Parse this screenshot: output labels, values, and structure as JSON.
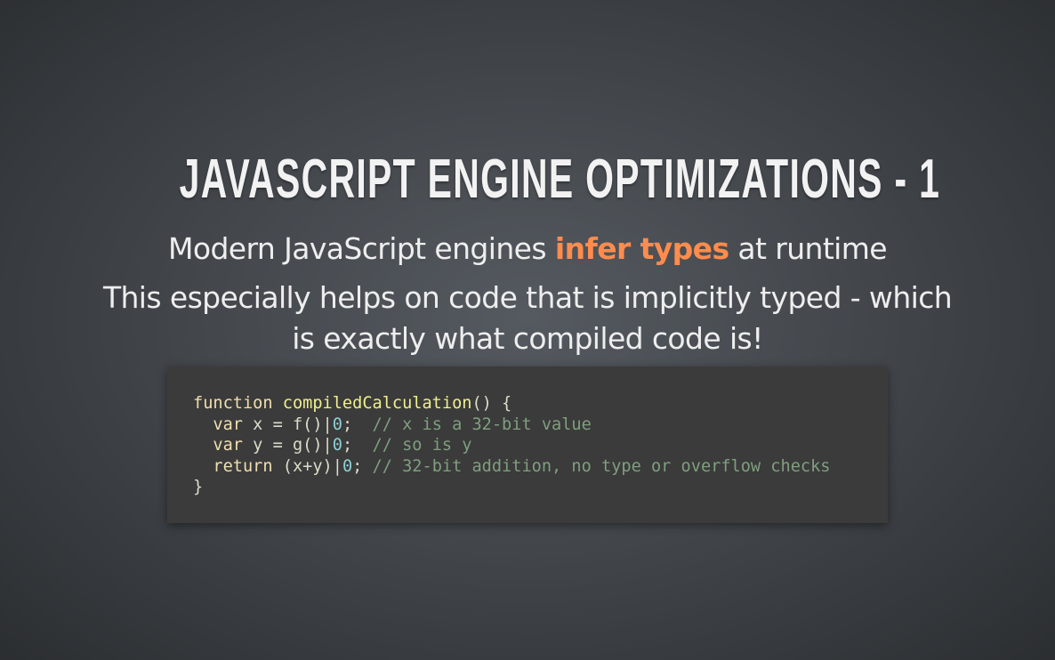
{
  "slide": {
    "title": "JavaScript Engine Optimizations - 1",
    "subtitle": {
      "before": "Modern JavaScript engines ",
      "highlight": "infer types",
      "after": " at runtime"
    },
    "body_lines": [
      "This especially helps on code that is implicitly typed - which",
      "is exactly what compiled code is!"
    ],
    "colors": {
      "highlight": "#ff8c4d",
      "code_background": "#3b3b3b",
      "code_comment": "#7f9f7f",
      "code_number": "#8cd0d3",
      "code_function": "#efef8f",
      "code_keyword": "#f0dfaf"
    }
  },
  "code": {
    "language": "javascript",
    "lines": [
      [
        {
          "t": "kw",
          "v": "function"
        },
        {
          "t": "pl",
          "v": " "
        },
        {
          "t": "fn",
          "v": "compiledCalculation"
        },
        {
          "t": "pl",
          "v": "() {"
        }
      ],
      [
        {
          "t": "pl",
          "v": "  "
        },
        {
          "t": "kw",
          "v": "var"
        },
        {
          "t": "pl",
          "v": " x = f()|"
        },
        {
          "t": "num",
          "v": "0"
        },
        {
          "t": "pl",
          "v": ";  "
        },
        {
          "t": "cm",
          "v": "// x is a 32-bit value"
        }
      ],
      [
        {
          "t": "pl",
          "v": "  "
        },
        {
          "t": "kw",
          "v": "var"
        },
        {
          "t": "pl",
          "v": " y = g()|"
        },
        {
          "t": "num",
          "v": "0"
        },
        {
          "t": "pl",
          "v": ";  "
        },
        {
          "t": "cm",
          "v": "// so is y"
        }
      ],
      [
        {
          "t": "pl",
          "v": "  "
        },
        {
          "t": "kw",
          "v": "return"
        },
        {
          "t": "pl",
          "v": " (x+y)|"
        },
        {
          "t": "num",
          "v": "0"
        },
        {
          "t": "pl",
          "v": "; "
        },
        {
          "t": "cm",
          "v": "// 32-bit addition, no type or overflow checks"
        }
      ],
      [
        {
          "t": "pl",
          "v": "}"
        }
      ]
    ]
  }
}
